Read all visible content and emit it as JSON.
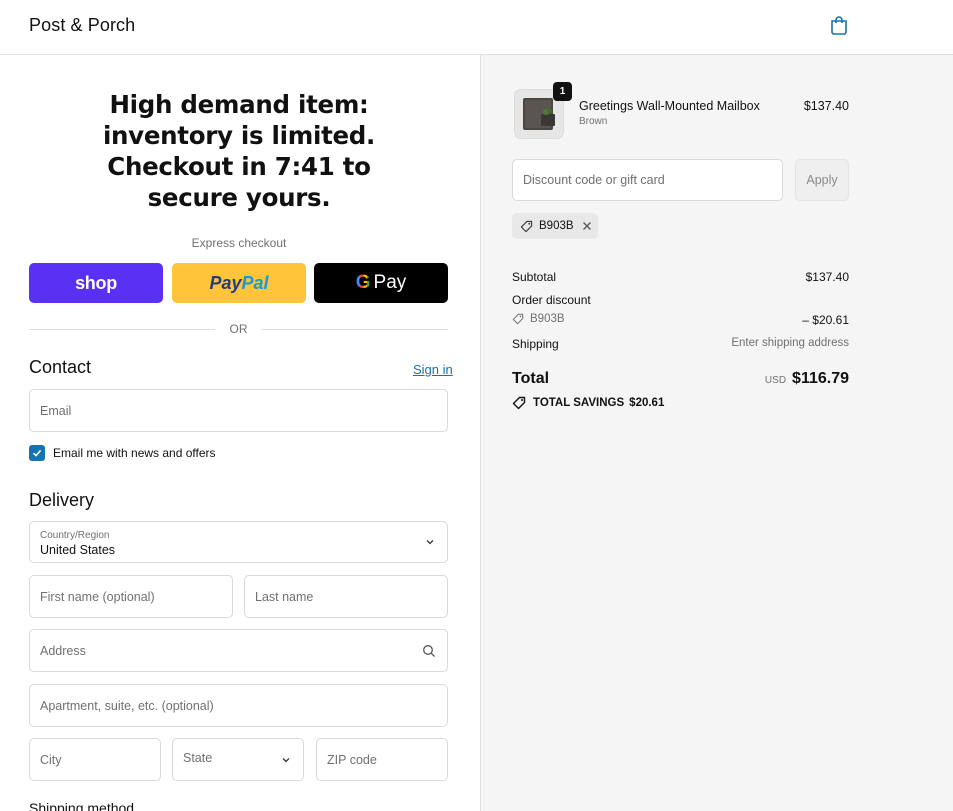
{
  "header": {
    "brand": "Post & Porch",
    "cart_icon": "shopping-bag-icon"
  },
  "urgency": {
    "message": "High demand item: inventory is limited. Checkout in 7:41 to secure yours."
  },
  "express": {
    "label": "Express checkout",
    "shop_label": "shop",
    "paypal_part1": "Pay",
    "paypal_part2": "Pal",
    "gpay_g": "G",
    "gpay_label": "Pay",
    "divider": "OR"
  },
  "contact": {
    "title": "Contact",
    "signin": "Sign in",
    "email_placeholder": "Email",
    "newsletter_label": "Email me with news and offers",
    "newsletter_checked": true
  },
  "delivery": {
    "title": "Delivery",
    "country_label": "Country/Region",
    "country_value": "United States",
    "first_name": "First name (optional)",
    "last_name": "Last name",
    "address": "Address",
    "apartment": "Apartment, suite, etc. (optional)",
    "city": "City",
    "state": "State",
    "zip": "ZIP code"
  },
  "shipping_method": {
    "title": "Shipping method"
  },
  "order": {
    "product": {
      "name": "Greetings Wall-Mounted Mailbox",
      "variant": "Brown",
      "price": "$137.40",
      "quantity": "1"
    },
    "discount_placeholder": "Discount code or gift card",
    "apply_label": "Apply",
    "applied_code": "B903B",
    "subtotal_label": "Subtotal",
    "subtotal_value": "$137.40",
    "order_discount_label": "Order discount",
    "discount_code": "B903B",
    "discount_value": "– $20.61",
    "shipping_label": "Shipping",
    "shipping_value": "Enter shipping address",
    "total_label": "Total",
    "currency": "USD",
    "total_value": "$116.79",
    "savings_label": "TOTAL SAVINGS",
    "savings_value": "$20.61"
  },
  "colors": {
    "shop": "#5a31f4",
    "paypal": "#ffc439",
    "gpay": "#000000",
    "link": "#1773b0",
    "summary_bg": "#f5f5f5"
  }
}
